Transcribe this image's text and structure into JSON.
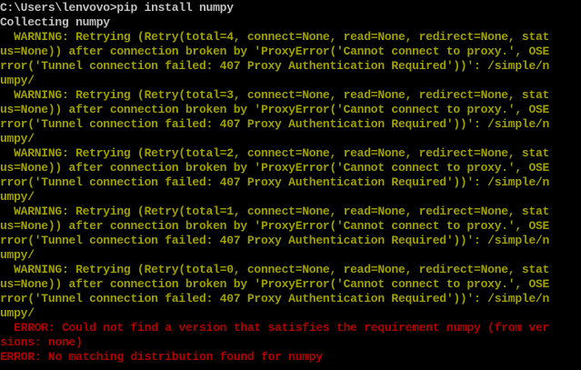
{
  "console": {
    "background": "#000000",
    "colors": {
      "plain": "#c0c0c0",
      "warning": "#a0a000",
      "error": "#b00000"
    },
    "lines": [
      "C:\\Users\\lenvovo>pip install numpy",
      "Collecting numpy",
      "  WARNING: Retrying (Retry(total=4, connect=None, read=None, redirect=None, stat",
      "us=None)) after connection broken by 'ProxyError('Cannot connect to proxy.', OSE",
      "rror('Tunnel connection failed: 407 Proxy Authentication Required'))': /simple/n",
      "umpy/",
      "  WARNING: Retrying (Retry(total=3, connect=None, read=None, redirect=None, stat",
      "us=None)) after connection broken by 'ProxyError('Cannot connect to proxy.', OSE",
      "rror('Tunnel connection failed: 407 Proxy Authentication Required'))': /simple/n",
      "umpy/",
      "  WARNING: Retrying (Retry(total=2, connect=None, read=None, redirect=None, stat",
      "us=None)) after connection broken by 'ProxyError('Cannot connect to proxy.', OSE",
      "rror('Tunnel connection failed: 407 Proxy Authentication Required'))': /simple/n",
      "umpy/",
      "  WARNING: Retrying (Retry(total=1, connect=None, read=None, redirect=None, stat",
      "us=None)) after connection broken by 'ProxyError('Cannot connect to proxy.', OSE",
      "rror('Tunnel connection failed: 407 Proxy Authentication Required'))': /simple/n",
      "umpy/",
      "  WARNING: Retrying (Retry(total=0, connect=None, read=None, redirect=None, stat",
      "us=None)) after connection broken by 'ProxyError('Cannot connect to proxy.', OSE",
      "rror('Tunnel connection failed: 407 Proxy Authentication Required'))': /simple/n",
      "umpy/",
      "  ERROR: Could not find a version that satisfies the requirement numpy (from ver",
      "sions: none)",
      "ERROR: No matching distribution found for numpy"
    ]
  }
}
